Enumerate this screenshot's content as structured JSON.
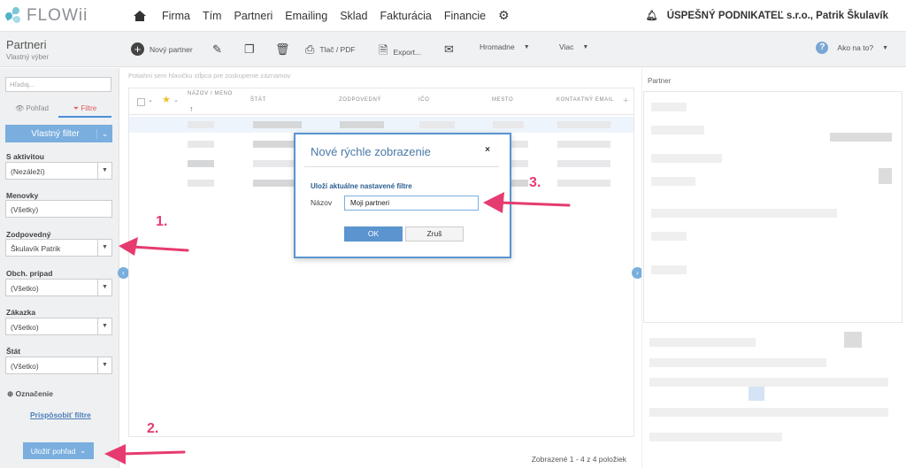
{
  "app": {
    "logo_text": "FLOWii",
    "nav": [
      "Firma",
      "Tím",
      "Partneri",
      "Emailing",
      "Sklad",
      "Fakturácia",
      "Financie"
    ],
    "company": "ÚSPEŠNÝ PODNIKATEĽ s.r.o., Patrik Škulavík"
  },
  "page": {
    "title": "Partneri",
    "subtitle": "Vlastný výber"
  },
  "toolbar": {
    "new_partner": "Nový partner",
    "print": "Tlač / PDF",
    "export": "Export...",
    "bulk": "Hromadne",
    "more": "Viac",
    "help": "Ako na to?"
  },
  "sidebar": {
    "search_placeholder": "Hľadaj...",
    "tab_view": "Pohľad",
    "tab_filters": "Filtre",
    "custom_filter": "Vlastný filter",
    "filters": [
      {
        "label": "S aktivitou",
        "value": "(Nezáleží)"
      },
      {
        "label": "Menovky",
        "value": "(Všetky)"
      },
      {
        "label": "Zodpovedný",
        "value": "Škulavík Patrik"
      },
      {
        "label": "Obch. prípad",
        "value": "(Všetko)"
      },
      {
        "label": "Zákazka",
        "value": "(Všetko)"
      },
      {
        "label": "Štát",
        "value": "(Všetko)"
      }
    ],
    "marking": "Označenie",
    "customize_filters": "Prispôsobiť filtre",
    "save_view": "Uložiť pohľad"
  },
  "grid": {
    "group_hint": "Potiahni sem hlavičku stĺpca pre zoskupenie záznamov",
    "columns": [
      "NÁZOV / MENO",
      "ŠTÁT",
      "ZODPOVEDNÝ",
      "IČO",
      "MESTO",
      "KONTAKTNÝ EMAIL"
    ],
    "footer": "Zobrazené 1 - 4 z 4 položiek"
  },
  "right_panel": {
    "title": "Partner"
  },
  "modal": {
    "title": "Nové rýchle zobrazenie",
    "close": "×",
    "subtitle": "Uloží aktuálne nastavené filtre",
    "name_label": "Názov",
    "name_value": "Moji partneri",
    "ok": "OK",
    "cancel": "Zruš"
  },
  "annotations": {
    "a1": "1.",
    "a2": "2.",
    "a3": "3.",
    "color": "#e63b6f"
  }
}
